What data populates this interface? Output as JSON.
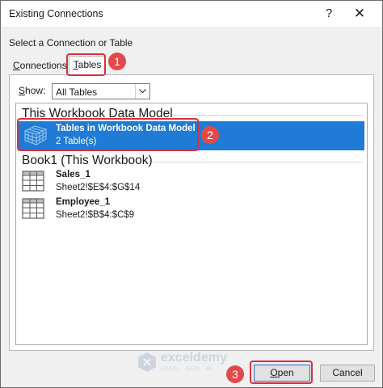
{
  "window": {
    "title": "Existing Connections",
    "help": "?",
    "close": "✕"
  },
  "select_label": "Select a Connection or Table",
  "tabs": [
    {
      "label_first": "C",
      "label_rest": "onnections",
      "active": false
    },
    {
      "label_first": "T",
      "label_rest": "ables",
      "active": true
    }
  ],
  "show": {
    "label_first": "S",
    "label_rest": "how:",
    "value": "All Tables"
  },
  "groups": [
    {
      "header": "This Workbook Data Model",
      "items": [
        {
          "name": "Tables in Workbook Data Model",
          "sub": "2 Table(s)",
          "icon": "data-model-cube-icon",
          "selected": true
        }
      ]
    },
    {
      "header": "Book1 (This Workbook)",
      "items": [
        {
          "name": "Sales_1",
          "sub": "Sheet2!$E$4:$G$14",
          "icon": "table-grid-icon",
          "selected": false
        },
        {
          "name": "Employee_1",
          "sub": "Sheet2!$B$4:$C$9",
          "icon": "table-grid-icon",
          "selected": false
        }
      ]
    }
  ],
  "buttons": {
    "open_first": "O",
    "open_rest": "pen",
    "cancel": "Cancel"
  },
  "annotations": {
    "badge1": "1",
    "badge2": "2",
    "badge3": "3",
    "accent": "#d4303f"
  },
  "watermark": {
    "name": "exceldemy",
    "tag": "EXCEL · DATA · BI"
  },
  "colors": {
    "selection": "#1f7bd6",
    "dialog_bg": "#f0f0f0"
  }
}
